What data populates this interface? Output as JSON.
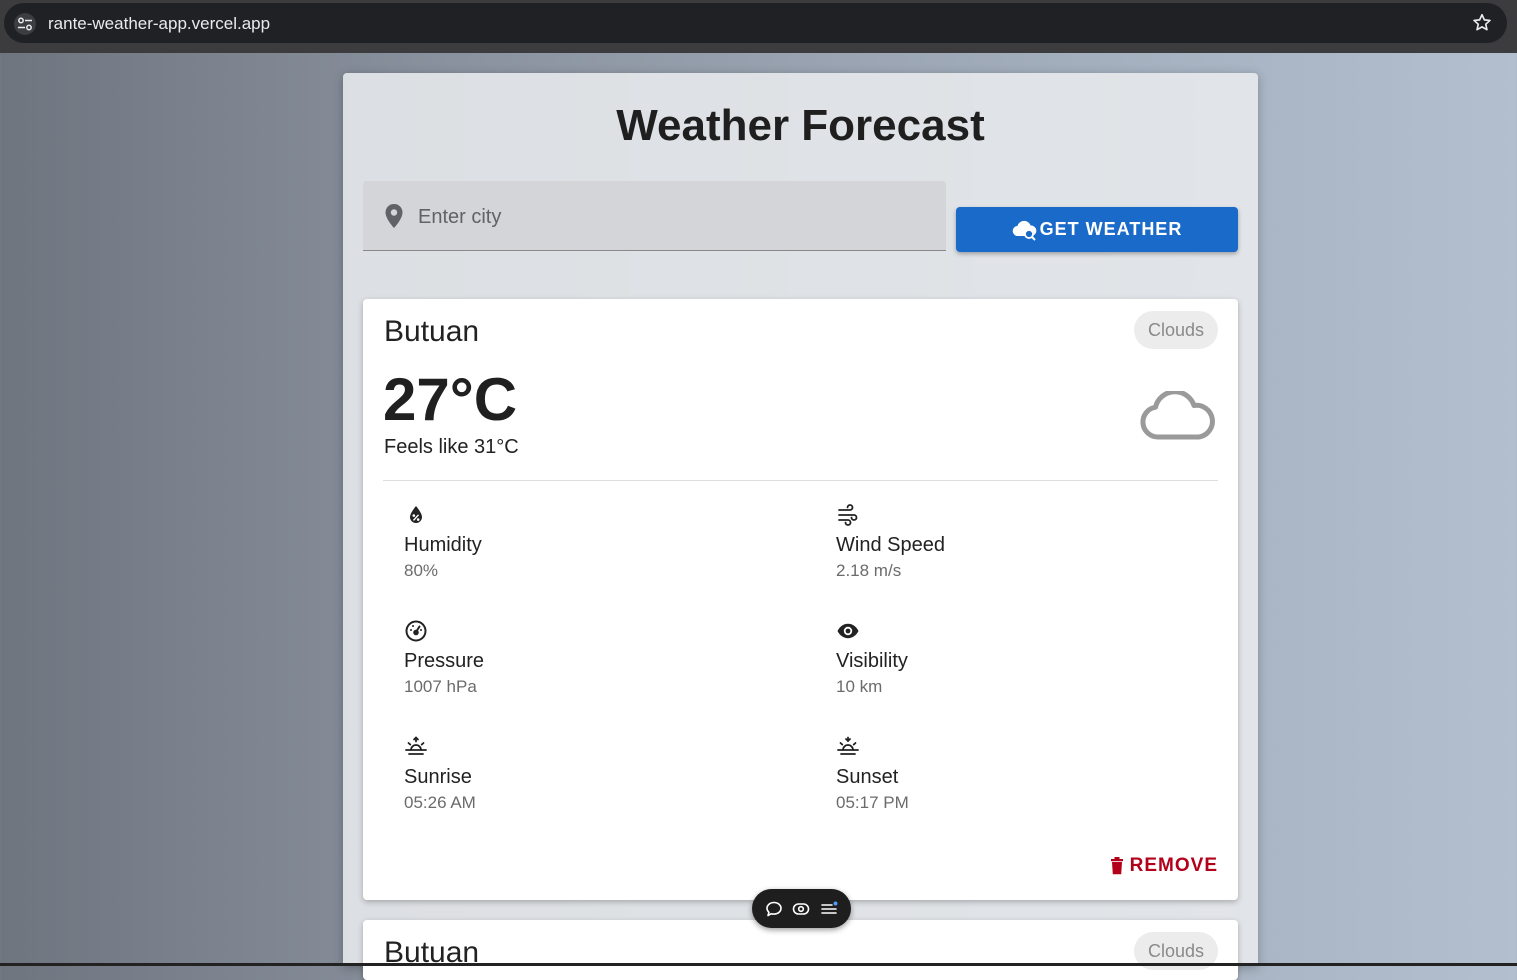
{
  "browser": {
    "url": "rante-weather-app.vercel.app"
  },
  "app": {
    "title": "Weather Forecast",
    "search": {
      "placeholder": "Enter city",
      "value": ""
    },
    "get_weather_label": "GET WEATHER"
  },
  "cards": [
    {
      "city": "Butuan",
      "condition": "Clouds",
      "temperature": "27°C",
      "feels_like": "Feels like 31°C",
      "metrics": {
        "humidity": {
          "label": "Humidity",
          "value": "80%",
          "icon": "humidity-icon"
        },
        "wind": {
          "label": "Wind Speed",
          "value": "2.18 m/s",
          "icon": "wind-icon"
        },
        "pressure": {
          "label": "Pressure",
          "value": "1007 hPa",
          "icon": "pressure-gauge-icon"
        },
        "visibility": {
          "label": "Visibility",
          "value": "10 km",
          "icon": "eye-icon"
        },
        "sunrise": {
          "label": "Sunrise",
          "value": "05:26 AM",
          "icon": "sunrise-icon"
        },
        "sunset": {
          "label": "Sunset",
          "value": "05:17 PM",
          "icon": "sunset-icon"
        }
      },
      "remove_label": "REMOVE"
    },
    {
      "city": "Butuan",
      "condition": "Clouds"
    }
  ],
  "colors": {
    "primary_button": "#1a6ac9",
    "remove": "#b3001b",
    "chip_bg": "#ececec"
  }
}
